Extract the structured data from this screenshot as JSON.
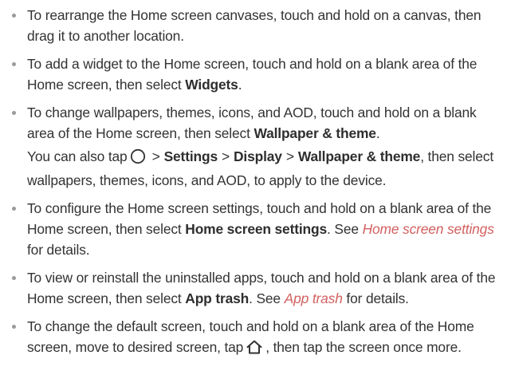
{
  "bullets": [
    {
      "text": "To rearrange the Home screen canvases, touch and hold on a canvas, then drag it to another location."
    },
    {
      "before": "To add a widget to the Home screen, touch and hold on a blank area of the Home screen, then select ",
      "bold": "Widgets",
      "after": "."
    },
    {
      "before": "To change wallpapers, themes, icons, and AOD, touch and hold on a blank area of the Home screen, then select ",
      "bold": "Wallpaper & theme",
      "after": "."
    },
    {
      "before": "To configure the Home screen settings, touch and hold on a blank area of the Home screen, then select ",
      "bold": "Home screen settings",
      "middle": ". See ",
      "link": "Home screen settings",
      "after": " for details."
    },
    {
      "before": "To view or reinstall the uninstalled apps, touch and hold on a blank area of the Home screen, then select ",
      "bold": "App trash",
      "middle": ". See ",
      "link": "App trash",
      "after": " for details."
    },
    {
      "before": "To change the default screen, touch and hold on a blank area of the Home screen, move to desired screen, tap",
      "after": ", then tap the screen once more."
    }
  ],
  "note": {
    "before": "You can also tap",
    "path": [
      "Settings",
      "Display",
      "Wallpaper & theme"
    ],
    "separator": ">",
    "after": ", then select wallpapers, themes, icons, and AOD, to apply to the device."
  },
  "icons": {
    "bullet": "bullet-dot-icon",
    "circle": "circle-button-icon",
    "home": "home-icon"
  },
  "colors": {
    "text": "#333333",
    "link": "#d2605f",
    "bullet": "#9a9a9a"
  }
}
